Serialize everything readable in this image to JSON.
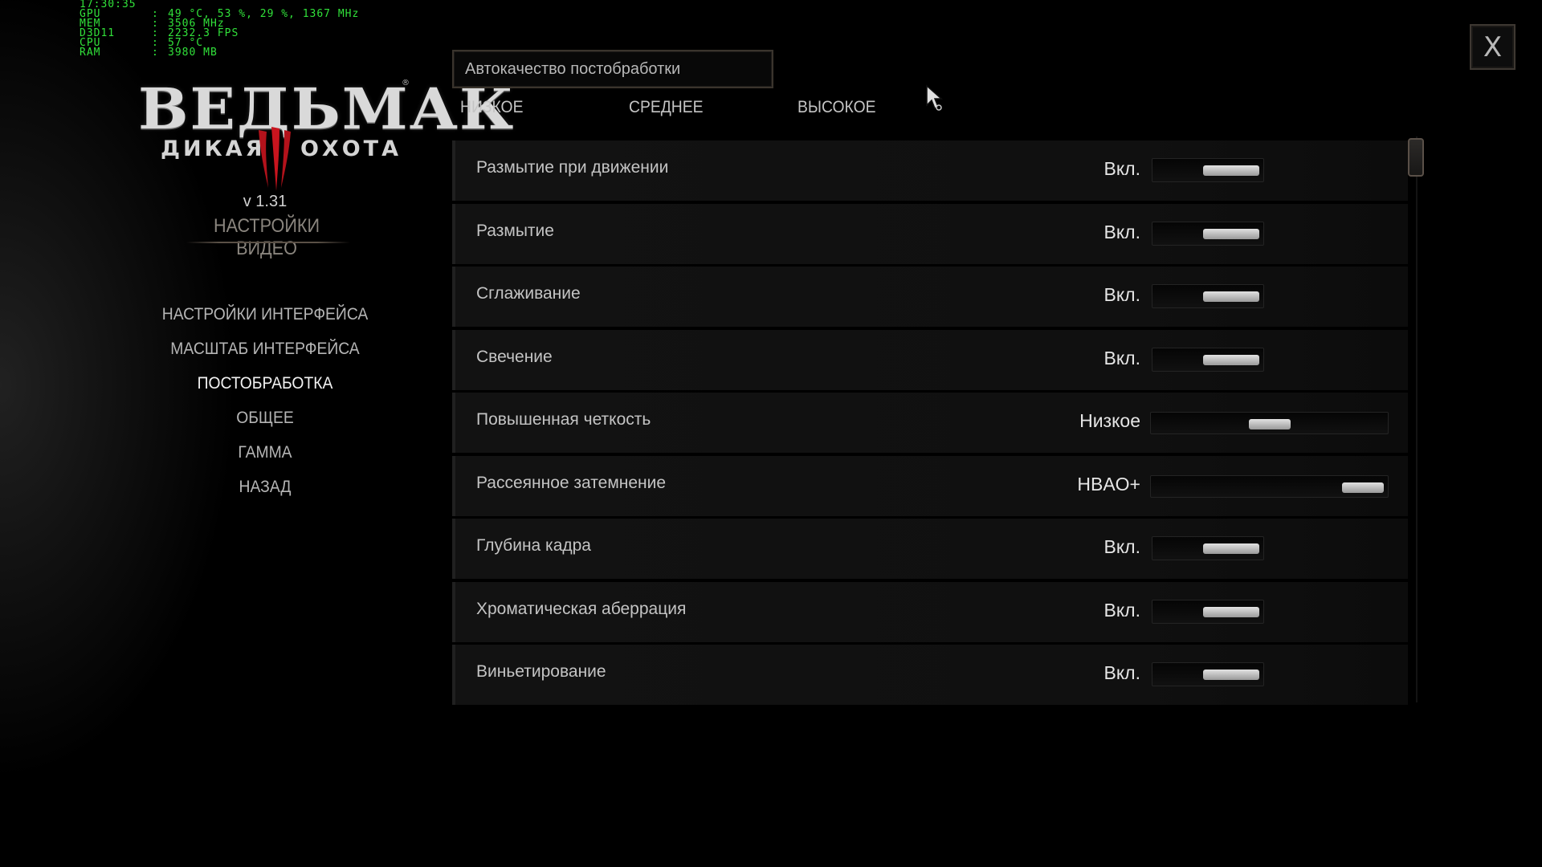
{
  "overlay": {
    "time": "17:30:35",
    "rows": [
      {
        "key": "GPU",
        "value": "49 °C, 53 %, 29 %, 1367 MHz"
      },
      {
        "key": "MEM",
        "value": "3506 MHz"
      },
      {
        "key": "D3D11",
        "value": "2232.3 FPS"
      },
      {
        "key": "CPU",
        "value": "57 °C"
      },
      {
        "key": "RAM",
        "value": "3980 MB"
      }
    ]
  },
  "logo": {
    "title": "ВЕДЬМАК",
    "subtitle_left": "ДИКАЯ",
    "subtitle_right": "ОХОТА",
    "reg": "®"
  },
  "version": "v 1.31",
  "section_title": "НАСТРОЙКИ ВИДЕО",
  "menu": {
    "items": [
      {
        "label": "НАСТРОЙКИ ИНТЕРФЕЙСА",
        "active": false
      },
      {
        "label": "МАСШТАБ ИНТЕРФЕЙСА",
        "active": false
      },
      {
        "label": "ПОСТОБРАБОТКА",
        "active": true
      },
      {
        "label": "ОБЩЕЕ",
        "active": false
      },
      {
        "label": "ГАММА",
        "active": false
      },
      {
        "label": "НАЗАД",
        "active": false
      }
    ]
  },
  "auto_quality": {
    "label": "Автокачество постобработки",
    "presets": [
      "НИЗКОЕ",
      "СРЕДНЕЕ",
      "ВЫСОКОЕ"
    ]
  },
  "settings": [
    {
      "label": "Размытие при движении",
      "value": "Вкл.",
      "control": "toggle",
      "on": true
    },
    {
      "label": "Размытие",
      "value": "Вкл.",
      "control": "toggle",
      "on": true
    },
    {
      "label": "Сглаживание",
      "value": "Вкл.",
      "control": "toggle",
      "on": true
    },
    {
      "label": "Свечение",
      "value": "Вкл.",
      "control": "toggle",
      "on": true
    },
    {
      "label": "Повышенная четкость",
      "value": "Низкое",
      "control": "slider",
      "level": 0.5
    },
    {
      "label": "Рассеянное затемнение",
      "value": "HBAO+",
      "control": "slider",
      "level": 1.0
    },
    {
      "label": "Глубина кадра",
      "value": "Вкл.",
      "control": "toggle",
      "on": true
    },
    {
      "label": "Хроматическая аберрация",
      "value": "Вкл.",
      "control": "toggle",
      "on": true
    },
    {
      "label": "Виньетирование",
      "value": "Вкл.",
      "control": "toggle",
      "on": true
    }
  ],
  "close_label": "X",
  "colors": {
    "osd": "#31e13a",
    "active_menu": "#f2f2f2",
    "section_title": "#8a857e",
    "frame": "#3e3832"
  }
}
